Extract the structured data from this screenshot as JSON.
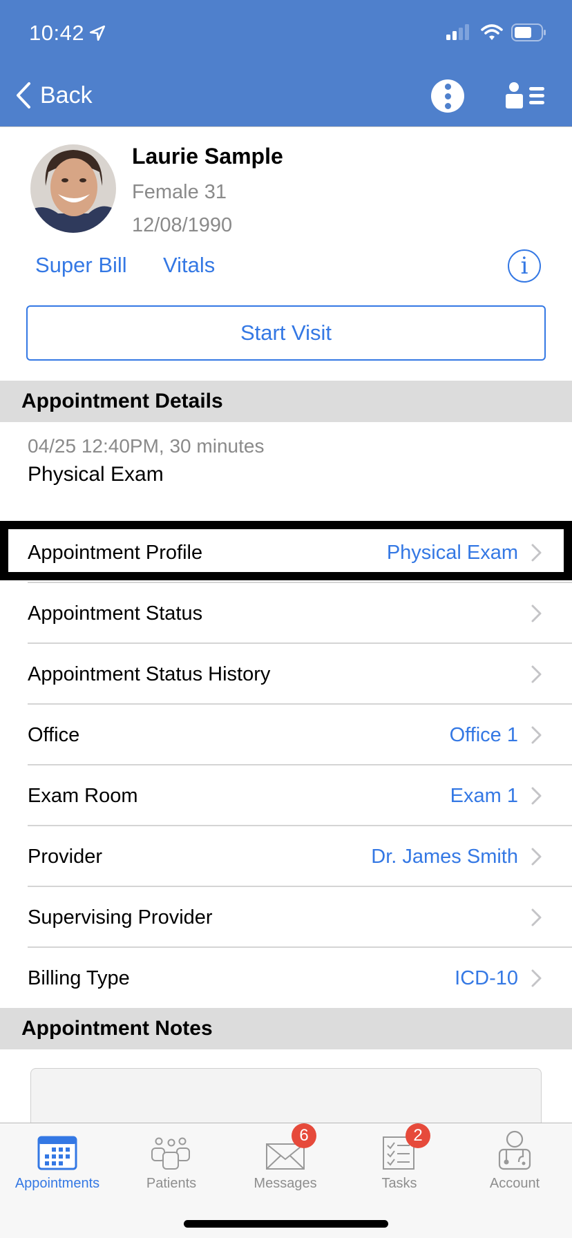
{
  "status_bar": {
    "time": "10:42",
    "icons": [
      "location-arrow-icon",
      "cellular-signal-icon",
      "wifi-icon",
      "battery-icon"
    ]
  },
  "nav": {
    "back_label": "Back",
    "icons": [
      "chevron-left-icon",
      "more-vertical-icon",
      "person-list-icon"
    ]
  },
  "patient": {
    "name": "Laurie Sample",
    "gender_age": "Female 31",
    "dob": "12/08/1990",
    "links": [
      "Super Bill",
      "Vitals"
    ],
    "info_glyph": "i",
    "start_visit_label": "Start Visit"
  },
  "appointment_details": {
    "header": "Appointment Details",
    "time": "04/25 12:40PM, 30 minutes",
    "type": "Physical Exam",
    "rows": [
      {
        "label": "Appointment Profile",
        "value": "Physical Exam",
        "highlighted": true
      },
      {
        "label": "Appointment Status",
        "value": ""
      },
      {
        "label": "Appointment Status History",
        "value": ""
      },
      {
        "label": "Office",
        "value": "Office 1"
      },
      {
        "label": "Exam Room",
        "value": "Exam 1"
      },
      {
        "label": "Provider",
        "value": "Dr. James Smith"
      },
      {
        "label": "Supervising Provider",
        "value": ""
      },
      {
        "label": "Billing Type",
        "value": "ICD-10"
      }
    ]
  },
  "appointment_notes": {
    "header": "Appointment Notes",
    "value": ""
  },
  "tabbar": {
    "tabs": [
      {
        "label": "Appointments",
        "icon": "calendar-icon",
        "active": true
      },
      {
        "label": "Patients",
        "icon": "people-icon"
      },
      {
        "label": "Messages",
        "icon": "envelope-icon",
        "badge": "6"
      },
      {
        "label": "Tasks",
        "icon": "checklist-icon",
        "badge": "2"
      },
      {
        "label": "Account",
        "icon": "doctor-icon"
      }
    ]
  },
  "colors": {
    "nav_blue": "#4f80cc",
    "link_blue": "#3478e4",
    "badge_red": "#e64a3b",
    "section_gray": "#dcdcdc"
  }
}
